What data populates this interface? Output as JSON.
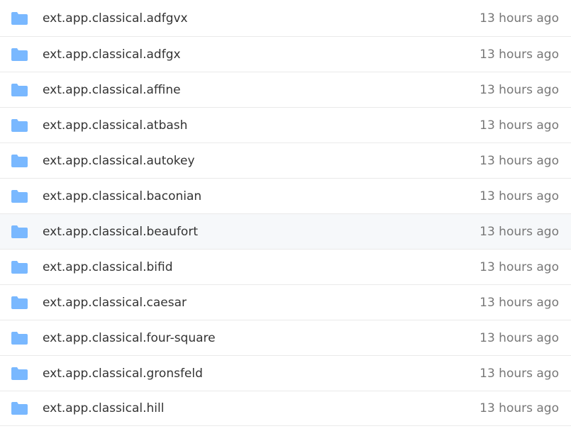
{
  "colors": {
    "folder_icon": "#79b8ff",
    "row_highlight": "#f6f8fa",
    "name_text": "#333333",
    "time_text": "#777777",
    "divider": "#eaeaea"
  },
  "rows": [
    {
      "icon": "folder-icon",
      "name": "ext.app.classical.adfgvx",
      "time": "13 hours ago"
    },
    {
      "icon": "folder-icon",
      "name": "ext.app.classical.adfgx",
      "time": "13 hours ago"
    },
    {
      "icon": "folder-icon",
      "name": "ext.app.classical.affine",
      "time": "13 hours ago"
    },
    {
      "icon": "folder-icon",
      "name": "ext.app.classical.atbash",
      "time": "13 hours ago"
    },
    {
      "icon": "folder-icon",
      "name": "ext.app.classical.autokey",
      "time": "13 hours ago"
    },
    {
      "icon": "folder-icon",
      "name": "ext.app.classical.baconian",
      "time": "13 hours ago"
    },
    {
      "icon": "folder-icon",
      "name": "ext.app.classical.beaufort",
      "time": "13 hours ago"
    },
    {
      "icon": "folder-icon",
      "name": "ext.app.classical.bifid",
      "time": "13 hours ago"
    },
    {
      "icon": "folder-icon",
      "name": "ext.app.classical.caesar",
      "time": "13 hours ago"
    },
    {
      "icon": "folder-icon",
      "name": "ext.app.classical.four-square",
      "time": "13 hours ago"
    },
    {
      "icon": "folder-icon",
      "name": "ext.app.classical.gronsfeld",
      "time": "13 hours ago"
    },
    {
      "icon": "folder-icon",
      "name": "ext.app.classical.hill",
      "time": "13 hours ago"
    }
  ]
}
